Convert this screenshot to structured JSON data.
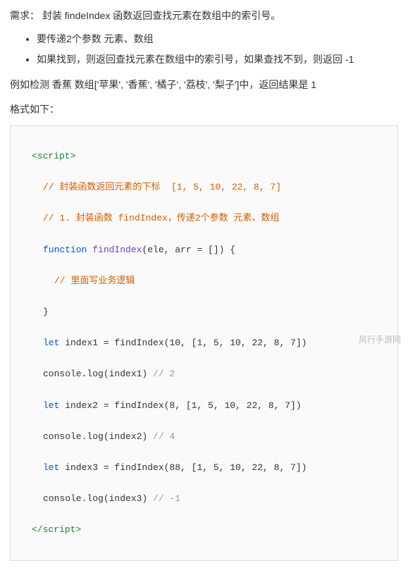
{
  "requirement": "需求：  封装 findeIndex 函数返回查找元素在数组中的索引号。",
  "bullets": [
    "要传递2个参数 元素、数组",
    "如果找到，则返回查找元素在数组中的索引号，如果查找不到，则返回 -1"
  ],
  "example": "例如检测 香蕉   数组['苹果', '香蕉', '橘子', '荔枝', '梨子']中，返回结果是 1",
  "formatLabel": "格式如下：",
  "code": {
    "l1": "<script>",
    "l2": "// 封装函数返回元素的下标  [1, 5, 10, 22, 8, 7]",
    "l3": "// 1. 封装函数 findIndex，传递2个参数 元素、数组",
    "l4a": "function",
    "l4b": " findIndex",
    "l4c": "(ele, arr = []) {",
    "l5": "// 里面写业务逻辑",
    "l6": "}",
    "l7a": "let",
    "l7b": " index1 = findIndex(10, [1, 5, 10, 22, 8, 7])",
    "l8a": "console.log(index1) ",
    "l8b": "// 2",
    "l9a": "let",
    "l9b": " index2 = findIndex(8, [1, 5, 10, 22, 8, 7])",
    "l10a": "console.log(index2) ",
    "l10b": "// 4",
    "l11a": "let",
    "l11b": " index3 = findIndex(88, [1, 5, 10, 22, 8, 7])",
    "l12a": "console.log(index3) ",
    "l12b": "// -1",
    "l13": "</script>"
  },
  "watermark": "风行手游网"
}
